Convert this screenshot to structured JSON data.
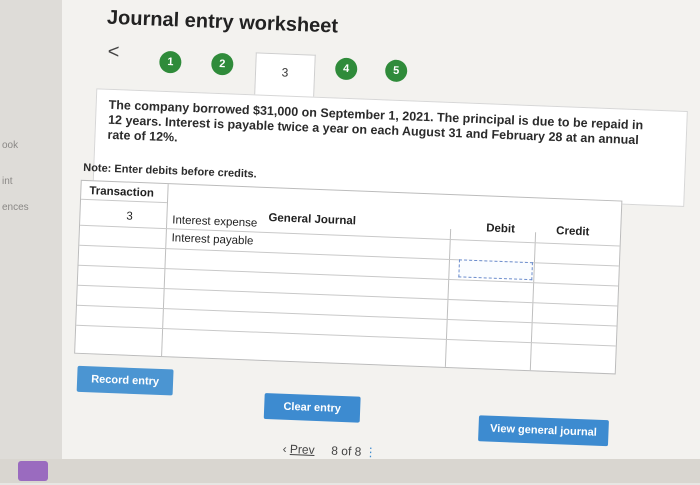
{
  "sidebar": {
    "items": [
      {
        "label": "ook"
      },
      {
        "label": "int"
      },
      {
        "label": "ences"
      }
    ]
  },
  "header": {
    "title": "Journal entry worksheet",
    "back_label": "<"
  },
  "steps": [
    "1",
    "2",
    "3",
    "4",
    "5"
  ],
  "problem": {
    "text": "The company borrowed $31,000 on September 1, 2021. The principal is due to be repaid in 12 years. Interest is payable twice a year on each August 31 and February 28 at an annual rate of 12%.",
    "note": "Note: Enter debits before credits."
  },
  "table": {
    "headers": {
      "transaction": "Transaction",
      "general_journal": "General Journal",
      "debit": "Debit",
      "credit": "Credit"
    },
    "rows": [
      {
        "transaction": "3",
        "account": "Interest expense",
        "debit": "",
        "credit": ""
      },
      {
        "transaction": "",
        "account": "Interest payable",
        "debit": "",
        "credit": ""
      },
      {
        "transaction": "",
        "account": "",
        "debit": "",
        "credit": ""
      },
      {
        "transaction": "",
        "account": "",
        "debit": "",
        "credit": ""
      },
      {
        "transaction": "",
        "account": "",
        "debit": "",
        "credit": ""
      },
      {
        "transaction": "",
        "account": "",
        "debit": "",
        "credit": ""
      },
      {
        "transaction": "",
        "account": "",
        "debit": "",
        "credit": ""
      }
    ]
  },
  "buttons": {
    "record": "Record entry",
    "clear": "Clear entry",
    "view": "View general journal"
  },
  "pager": {
    "prev": "Prev",
    "current": "8",
    "of": "of",
    "total": "8"
  },
  "colors": {
    "step_green": "#2f8b3a",
    "button_blue": "#3d8bd0"
  }
}
